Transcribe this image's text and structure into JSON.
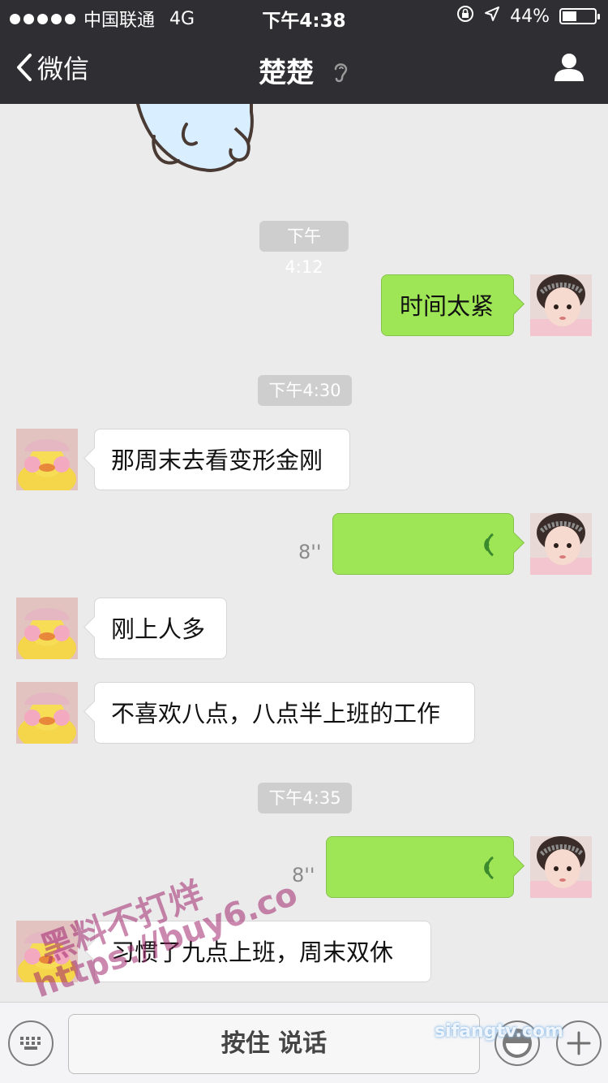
{
  "status_bar": {
    "carrier": "中国联通",
    "network": "4G",
    "time": "下午4:38",
    "battery": "44%",
    "battery_level": 0.44
  },
  "nav": {
    "back_label": "微信",
    "title": "楚楚"
  },
  "messages": {
    "t1": "下午4:12",
    "m1": "时间太紧",
    "t2": "下午4:30",
    "m2": "那周末去看变形金刚",
    "v1_duration": "8''",
    "m3": "刚上人多",
    "m4": "不喜欢八点，八点半上班的工作",
    "t3": "下午4:35",
    "v2_duration": "8''",
    "m5": "习惯了九点上班，周末双休"
  },
  "input_bar": {
    "hold_to_talk": "按住 说话"
  },
  "watermarks": {
    "line1": "黑料不打烊",
    "line2": "https://buy6.co",
    "line3": "sifangtv.com"
  },
  "colors": {
    "nav_bg": "#2f2f33",
    "chat_bg": "#ebebeb",
    "sent_bubble": "#9fe657",
    "received_bubble": "#ffffff"
  }
}
